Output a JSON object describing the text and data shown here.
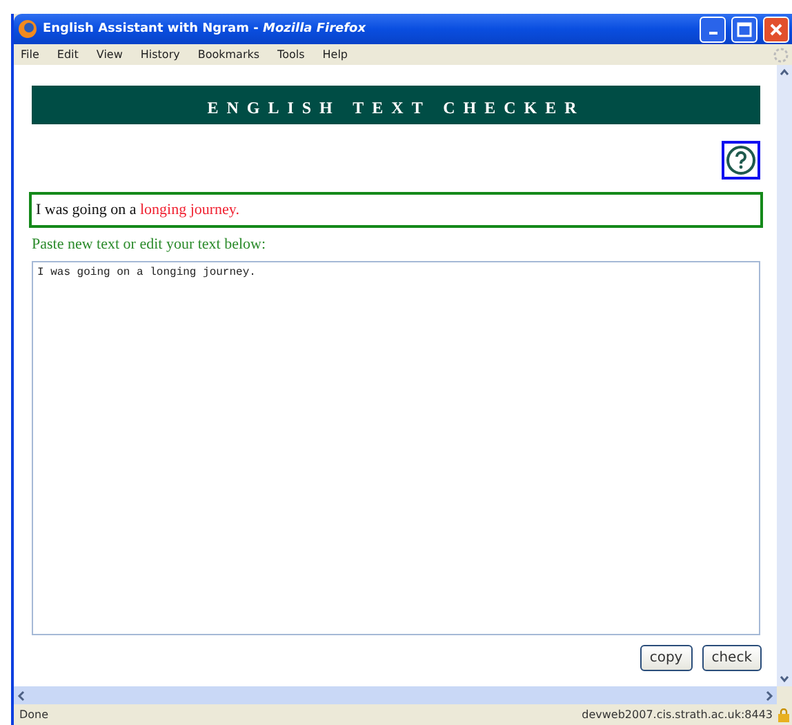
{
  "window": {
    "title_app": "English Assistant with Ngram - ",
    "title_browser": "Mozilla Firefox"
  },
  "menu": [
    "File",
    "Edit",
    "View",
    "History",
    "Bookmarks",
    "Tools",
    "Help"
  ],
  "banner": "ENGLISH TEXT CHECKER",
  "result": [
    {
      "kind": "plain",
      "text": "I was going on a "
    },
    {
      "kind": "error",
      "text": "longing journey"
    },
    {
      "kind": "error",
      "text": "."
    }
  ],
  "prompt": "Paste new text or edit your text below:",
  "text_input": {
    "value": "I was going on a longing journey."
  },
  "buttons": [
    "copy",
    "check"
  ],
  "status_bar": {
    "left": "Done",
    "right": "devweb2007.cis.strath.ac.uk:8443"
  }
}
